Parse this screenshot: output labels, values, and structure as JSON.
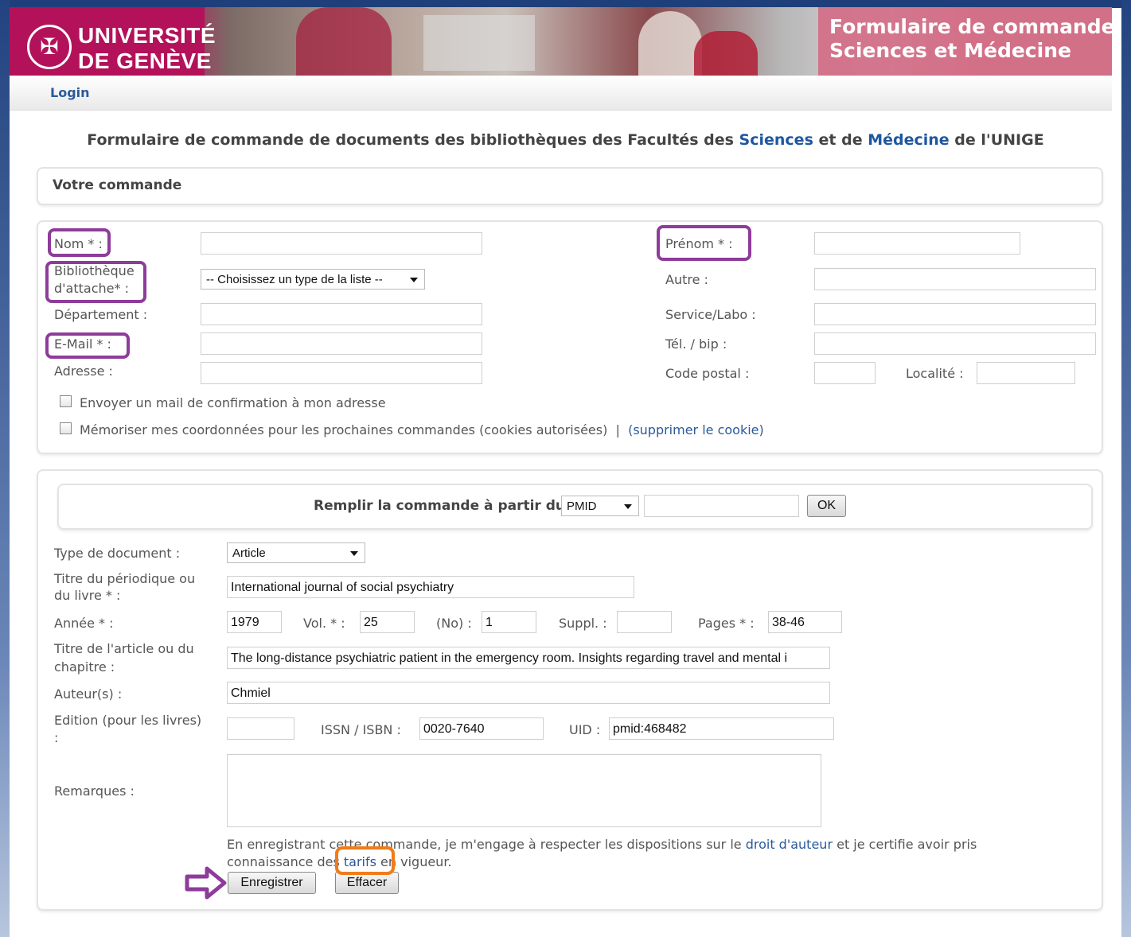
{
  "header": {
    "logo_line1": "UNIVERSITÉ",
    "logo_line2": "DE GENÈVE",
    "title_line1": "Formulaire de commande",
    "title_line2": "Sciences et Médecine"
  },
  "login": "Login",
  "page_title": {
    "part1": "Formulaire de commande de documents des bibliothèques des Facultés des ",
    "sciences": "Sciences",
    "part2": " et de ",
    "medecine": "Médecine",
    "part3": " de l'UNIGE"
  },
  "order_heading": "Votre commande",
  "user_form": {
    "nom_label": "Nom * :",
    "prenom_label": "Prénom * :",
    "bibliotheque_label_1": "Bibliothèque",
    "bibliotheque_label_2": "d'attache* :",
    "bibliotheque_select": "-- Choisissez un type de la liste --",
    "autre_label": "Autre :",
    "departement_label": "Département :",
    "service_label": "Service/Labo :",
    "email_label": "E-Mail * :",
    "tel_label": "Tél. / bip :",
    "adresse_label": "Adresse :",
    "code_postal_label": "Code postal :",
    "localite_label": "Localité :",
    "confirm_mail": "Envoyer un mail de confirmation à mon adresse",
    "remember": "Mémoriser mes coordonnées pour les prochaines commandes (cookies autorisées)",
    "separator": "|",
    "cookie_open": "(",
    "cookie_link": "supprimer le cookie",
    "cookie_close": ")"
  },
  "doc_form": {
    "fill_label": "Remplir la commande à partir du",
    "fill_select": "PMID",
    "ok": "OK",
    "type_label": "Type de document :",
    "type_value": "Article",
    "periodique_label_1": "Titre du périodique ou",
    "periodique_label_2": "du livre * :",
    "periodique_value": "International journal of social psychiatry",
    "annee_label": "Année * :",
    "annee_value": "1979",
    "vol_label": "Vol. * :",
    "vol_value": "25",
    "no_label": "(No) :",
    "no_value": "1",
    "suppl_label": "Suppl. :",
    "suppl_value": "",
    "pages_label": "Pages * :",
    "pages_value": "38-46",
    "article_label_1": "Titre de l'article ou du",
    "article_label_2": "chapitre :",
    "article_value": "The long-distance psychiatric patient in the emergency room. Insights regarding travel and mental i",
    "auteur_label": "Auteur(s) :",
    "auteur_value": "Chmiel",
    "edition_label_1": "Edition (pour les livres)",
    "edition_label_2": ":",
    "edition_value": "",
    "issn_label": "ISSN / ISBN :",
    "issn_value": "0020-7640",
    "uid_label": "UID :",
    "uid_value": "pmid:468482",
    "remarques_label": "Remarques :",
    "notice_1": "En enregistrant cette commande, je m'engage à respecter les dispositions sur le ",
    "droit_link": "droit d'auteur",
    "notice_2": " et je certifie avoir pris",
    "notice_3": "connaissance des ",
    "tarifs_link": "tarifs",
    "notice_4": " en vigueur.",
    "save": "Enregistrer",
    "clear": "Effacer"
  },
  "colors": {
    "brand": "#b3125a",
    "link": "#2a5a9a",
    "annotation_purple": "#8e3c9a",
    "annotation_orange": "#f07c1a"
  }
}
